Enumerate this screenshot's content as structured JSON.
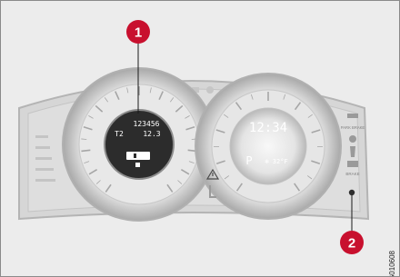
{
  "speedometer_display": {
    "odometer": "123456",
    "trip_label": "T2",
    "trip_value": "12.3"
  },
  "tachometer_display": {
    "clock": "12:34",
    "gear": "P",
    "outside_temp": "❄ 32°F"
  },
  "indicator_labels": {
    "park_brake": "PARK BRAKE",
    "brake": "BRAKE"
  },
  "callouts": [
    {
      "number": "1"
    },
    {
      "number": "2"
    }
  ],
  "reference_code": "G010608"
}
